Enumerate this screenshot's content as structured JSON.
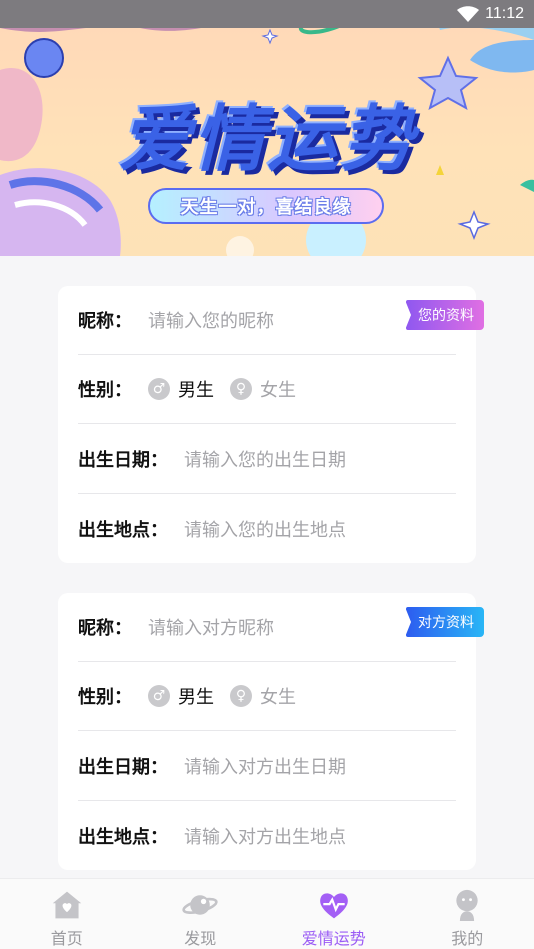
{
  "status_bar": {
    "time": "11:12"
  },
  "banner": {
    "title": "爱情运势",
    "subtitle": "天生一对，喜结良缘"
  },
  "cards": [
    {
      "tag": "您的资料",
      "nickname_label": "昵称：",
      "nickname_placeholder": "请输入您的昵称",
      "gender_label": "性别：",
      "gender_male": "男生",
      "gender_female": "女生",
      "birthdate_label": "出生日期：",
      "birthdate_placeholder": "请输入您的出生日期",
      "birthplace_label": "出生地点：",
      "birthplace_placeholder": "请输入您的出生地点"
    },
    {
      "tag": "对方资料",
      "nickname_label": "昵称：",
      "nickname_placeholder": "请输入对方昵称",
      "gender_label": "性别：",
      "gender_male": "男生",
      "gender_female": "女生",
      "birthdate_label": "出生日期：",
      "birthdate_placeholder": "请输入对方出生日期",
      "birthplace_label": "出生地点：",
      "birthplace_placeholder": "请输入对方出生地点"
    }
  ],
  "bottom_nav": [
    {
      "label": "首页",
      "icon": "home-icon",
      "active": false
    },
    {
      "label": "发现",
      "icon": "planet-icon",
      "active": false
    },
    {
      "label": "爱情运势",
      "icon": "heart-pulse-icon",
      "active": true
    },
    {
      "label": "我的",
      "icon": "profile-icon",
      "active": false
    }
  ],
  "colors": {
    "accent": "#9b5cf5",
    "tag_pink": "#c067e8",
    "tag_blue": "#2d7cf0",
    "banner_title": "#3a62e6"
  }
}
